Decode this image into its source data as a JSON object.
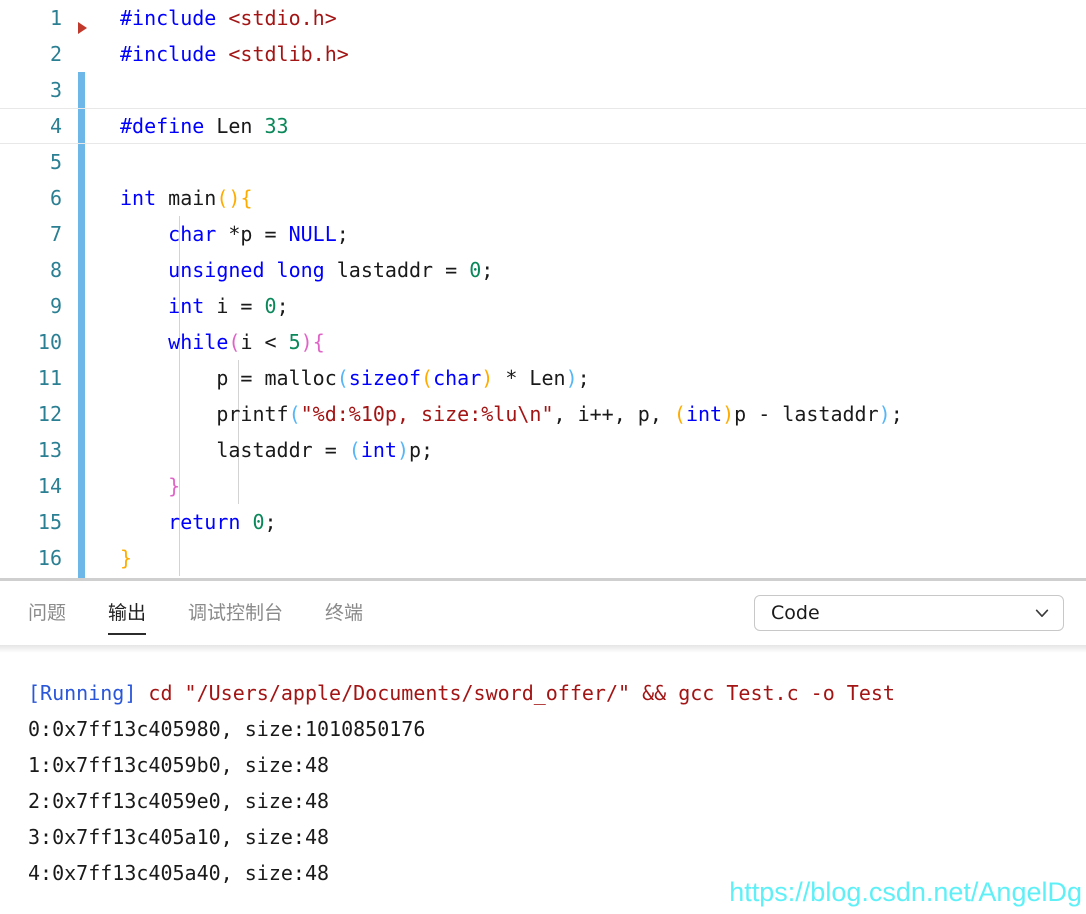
{
  "editor": {
    "language": "c",
    "current_line": 4,
    "gutter_marker_icon": "fold-arrow-icon",
    "lines": [
      {
        "num": "1",
        "text": "#include <stdio.h>"
      },
      {
        "num": "2",
        "text": "#include <stdlib.h>"
      },
      {
        "num": "3",
        "text": ""
      },
      {
        "num": "4",
        "text": "#define Len 33"
      },
      {
        "num": "5",
        "text": ""
      },
      {
        "num": "6",
        "text": "int main(){"
      },
      {
        "num": "7",
        "text": "    char *p = NULL;"
      },
      {
        "num": "8",
        "text": "    unsigned long lastaddr = 0;"
      },
      {
        "num": "9",
        "text": "    int i = 0;"
      },
      {
        "num": "10",
        "text": "    while(i < 5){"
      },
      {
        "num": "11",
        "text": "        p = malloc(sizeof(char) * Len);"
      },
      {
        "num": "12",
        "text": "        printf(\"%d:%10p, size:%lu\\n\", i++, p, (int)p - lastaddr);"
      },
      {
        "num": "13",
        "text": "        lastaddr = (int)p;"
      },
      {
        "num": "14",
        "text": "    }"
      },
      {
        "num": "15",
        "text": "    return 0;"
      },
      {
        "num": "16",
        "text": "}"
      }
    ]
  },
  "panel": {
    "tabs": [
      {
        "label": "问题",
        "active": false
      },
      {
        "label": "输出",
        "active": true
      },
      {
        "label": "调试控制台",
        "active": false
      },
      {
        "label": "终端",
        "active": false
      }
    ],
    "channel_selector": {
      "value": "Code",
      "icon": "chevron-down-icon"
    },
    "output": {
      "running_tag": "[Running]",
      "command": " cd \"/Users/apple/Documents/sword_offer/\" && gcc Test.c -o Test ",
      "lines": [
        "0:0x7ff13c405980, size:1010850176",
        "1:0x7ff13c4059b0, size:48",
        "2:0x7ff13c4059e0, size:48",
        "3:0x7ff13c405a10, size:48",
        "4:0x7ff13c405a40, size:48"
      ]
    }
  },
  "watermark": {
    "text": "https://blog.csdn.net/AngelDg"
  },
  "colors": {
    "line_number": "#2b7f93",
    "gutter_bar": "#6cb6e8",
    "fold_marker": "#c0392b",
    "preprocessor": "#0000ff",
    "header_string": "#a31515",
    "keyword": "#0000ff",
    "number": "#09885a",
    "string": "#a31515",
    "bracket_gold": "#ffab00",
    "bracket_blue": "#56b6f7",
    "bracket_magenta": "#e064c8",
    "running_tag": "#2a56d8",
    "command": "#a31515",
    "watermark": "#5ff0f7"
  }
}
